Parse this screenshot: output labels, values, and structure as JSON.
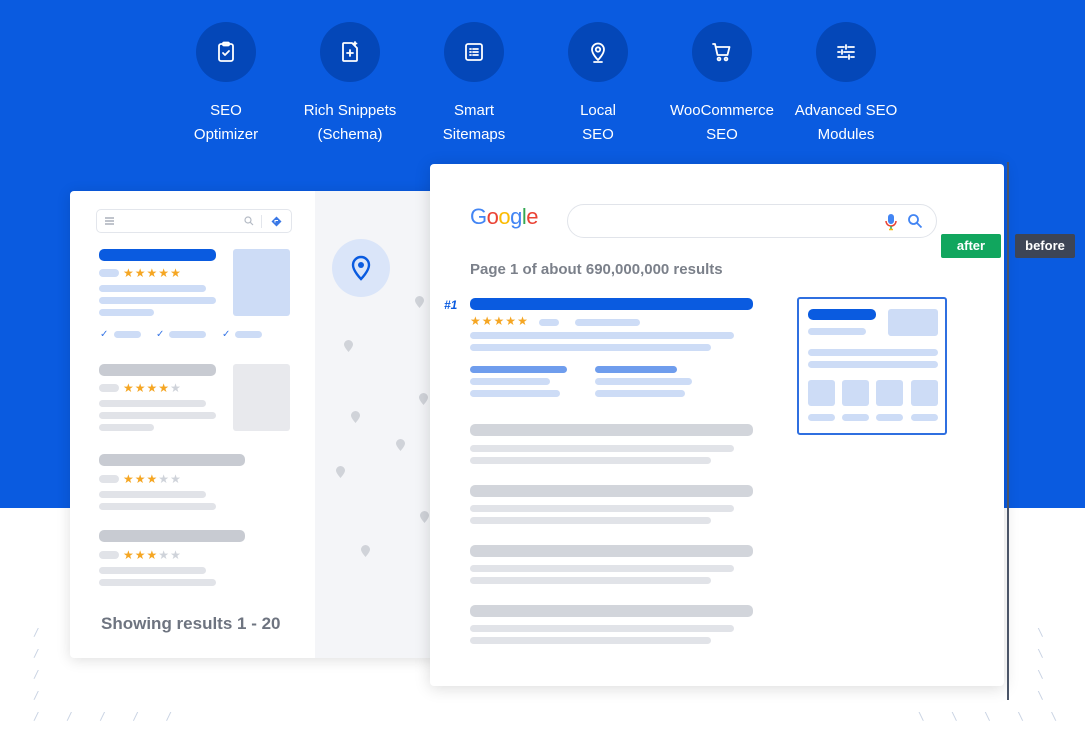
{
  "features": [
    {
      "label": "SEO\nOptimizer",
      "icon": "clipboard-check-icon"
    },
    {
      "label": "Rich Snippets\n(Schema)",
      "icon": "document-sparkle-icon"
    },
    {
      "label": "Smart\nSitemaps",
      "icon": "list-document-icon"
    },
    {
      "label": "Local\nSEO",
      "icon": "location-pin-icon"
    },
    {
      "label": "WooCommerce\nSEO",
      "icon": "shopping-cart-icon"
    },
    {
      "label": "Advanced SEO\nModules",
      "icon": "sliders-icon"
    }
  ],
  "local_listing": {
    "showing_text": "Showing results 1 - 20",
    "ratings": [
      5,
      4,
      3,
      3
    ]
  },
  "serp": {
    "logo": "Google",
    "results_count": "Page 1 of about 690,000,000 results",
    "rank_label": "#1",
    "top_rating": 5
  },
  "comparison": {
    "after_label": "after",
    "before_label": "before"
  },
  "colors": {
    "brand_blue": "#0a5be0",
    "icon_circle": "#0447b8",
    "star": "#f5a623",
    "after": "#11a65e",
    "before": "#3d4556"
  }
}
